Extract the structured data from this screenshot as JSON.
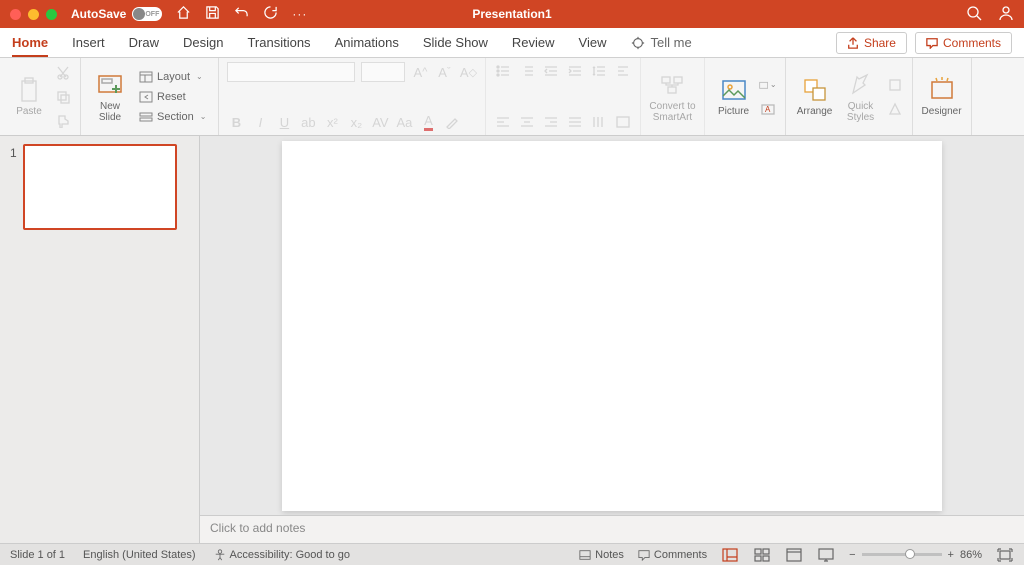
{
  "titlebar": {
    "autosave_label": "AutoSave",
    "autosave_state": "OFF",
    "title": "Presentation1"
  },
  "tabs": {
    "items": [
      "Home",
      "Insert",
      "Draw",
      "Design",
      "Transitions",
      "Animations",
      "Slide Show",
      "Review",
      "View"
    ],
    "active": 0,
    "tellme": "Tell me",
    "share": "Share",
    "comments": "Comments"
  },
  "ribbon": {
    "paste": "Paste",
    "newslide": "New\nSlide",
    "layout": "Layout",
    "reset": "Reset",
    "section": "Section",
    "convert": "Convert to\nSmartArt",
    "picture": "Picture",
    "arrange": "Arrange",
    "quickstyles": "Quick\nStyles",
    "designer": "Designer"
  },
  "thumbs": {
    "slides": [
      {
        "num": "1"
      }
    ]
  },
  "notes_placeholder": "Click to add notes",
  "status": {
    "slide": "Slide 1 of 1",
    "lang": "English (United States)",
    "a11y": "Accessibility: Good to go",
    "notes": "Notes",
    "comments": "Comments",
    "zoom": "86%"
  }
}
